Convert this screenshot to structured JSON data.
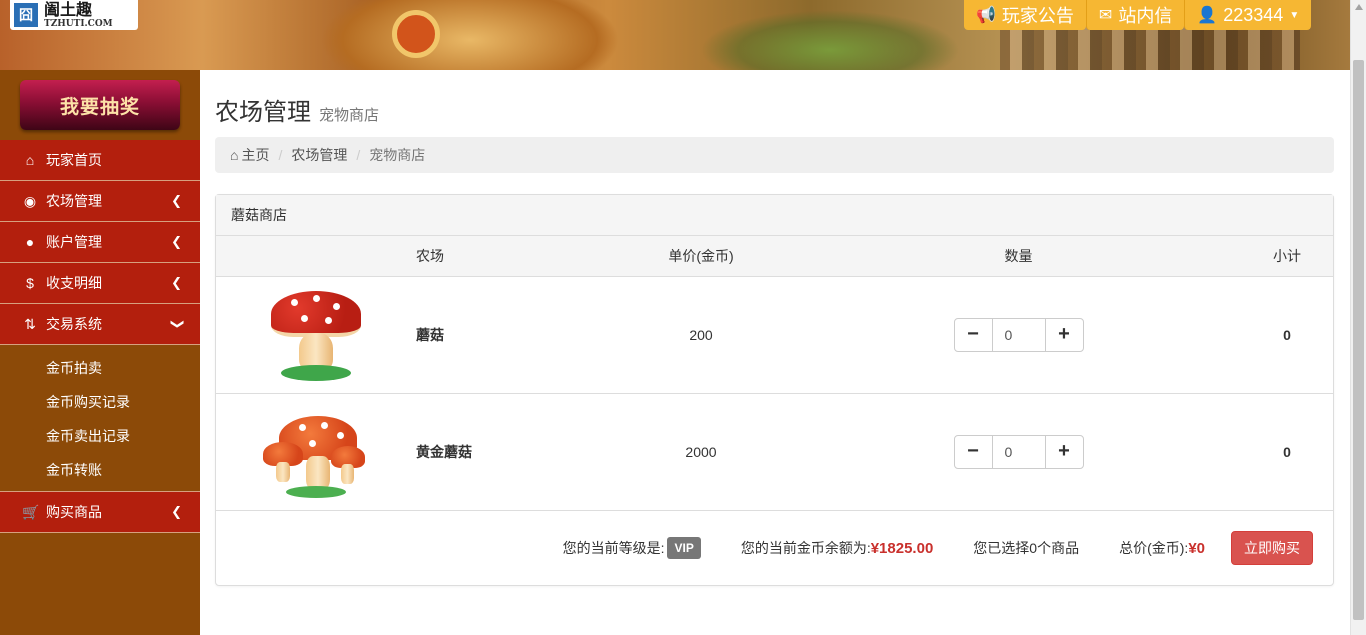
{
  "header": {
    "logo_mark": "囧",
    "logo_cn": "阖土趣",
    "logo_en": "TZHUTI.COM",
    "nav": [
      {
        "icon": "megaphone-icon",
        "label": "玩家公告"
      },
      {
        "icon": "envelope-icon",
        "label": "站内信"
      },
      {
        "icon": "user-icon",
        "label": "223344"
      }
    ]
  },
  "sidebar": {
    "lottery_label": "我要抽奖",
    "items": [
      {
        "label": "玩家首页",
        "icon": "home-icon"
      },
      {
        "label": "农场管理",
        "icon": "piggy-bank-icon"
      },
      {
        "label": "账户管理",
        "icon": "user-icon"
      },
      {
        "label": "收支明细",
        "icon": "dollar-icon"
      },
      {
        "label": "交易系统",
        "icon": "retweet-icon"
      }
    ],
    "subitems": [
      "金币拍卖",
      "金币购买记录",
      "金币卖出记录",
      "金币转账"
    ],
    "last_item": {
      "label": "购买商品",
      "icon": "cart-icon"
    }
  },
  "page": {
    "title": "农场管理",
    "subtitle": "宠物商店",
    "breadcrumb": [
      "主页",
      "农场管理",
      "宠物商店"
    ]
  },
  "panel": {
    "heading": "蘑菇商店",
    "columns": [
      "",
      "农场",
      "单价(金币)",
      "数量",
      "小计"
    ],
    "rows": [
      {
        "name": "蘑菇",
        "price": "200",
        "qty": "0",
        "subtotal": "0"
      },
      {
        "name": "黄金蘑菇",
        "price": "2000",
        "qty": "0",
        "subtotal": "0"
      }
    ],
    "footer": {
      "level_label": "您的当前等级是:",
      "level_badge": "VIP",
      "balance_label": "您的当前金币余额为:",
      "balance_value": "¥1825.00",
      "selected_text": "您已选择0个商品",
      "total_label": "总价(金币):",
      "total_value": "¥0",
      "buy_label": "立即购买"
    }
  },
  "colors": {
    "sidebar_bg": "#8c4a08",
    "menu_active": "#b31f0d",
    "nav_btn": "#f6b733",
    "buy_btn": "#d9534f",
    "money": "#c9302c"
  }
}
